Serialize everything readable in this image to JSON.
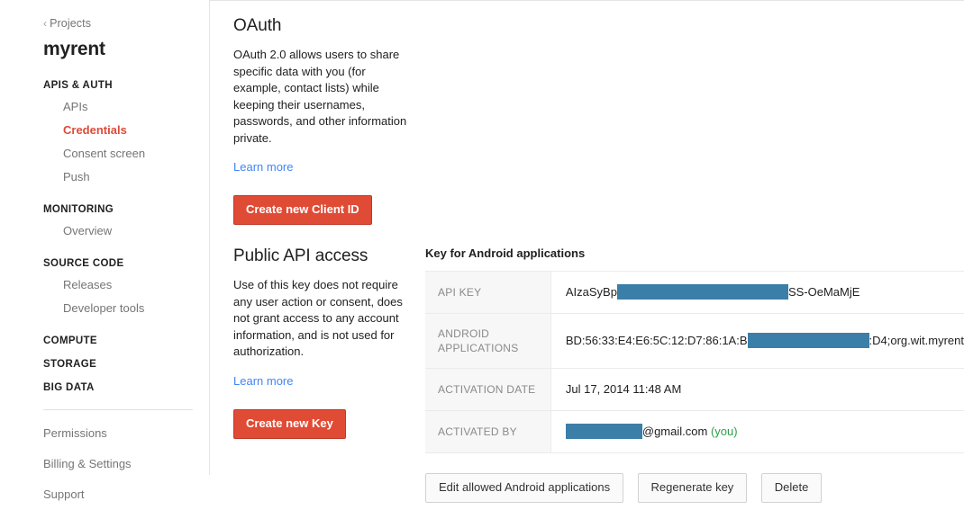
{
  "sidebar": {
    "breadcrumb": {
      "chevron": "‹",
      "label": "Projects"
    },
    "project_title": "myrent",
    "groups": [
      {
        "heading": "APIS & AUTH",
        "items": [
          {
            "label": "APIs",
            "active": false
          },
          {
            "label": "Credentials",
            "active": true
          },
          {
            "label": "Consent screen",
            "active": false
          },
          {
            "label": "Push",
            "active": false
          }
        ]
      },
      {
        "heading": "MONITORING",
        "items": [
          {
            "label": "Overview",
            "active": false
          }
        ]
      },
      {
        "heading": "SOURCE CODE",
        "items": [
          {
            "label": "Releases",
            "active": false
          },
          {
            "label": "Developer tools",
            "active": false
          }
        ]
      }
    ],
    "standalone_headings": [
      "COMPUTE",
      "STORAGE",
      "BIG DATA"
    ],
    "footer_items": [
      "Permissions",
      "Billing & Settings",
      "Support"
    ],
    "active_color": "#dd4b39"
  },
  "oauth": {
    "title": "OAuth",
    "body": "OAuth 2.0 allows users to share specific data with you (for example, contact lists) while keeping their usernames, passwords, and other information private.",
    "learn_more": "Learn more",
    "button": "Create new Client ID"
  },
  "public_api": {
    "title": "Public API access",
    "body": "Use of this key does not require any user action or consent, does not grant access to any account information, and is not used for authorization.",
    "learn_more": "Learn more",
    "button": "Create new Key"
  },
  "key_panel": {
    "heading": "Key for Android applications",
    "rows": {
      "api_key": {
        "label": "API KEY",
        "prefix": "AIzaSyBp",
        "redacted_width": 190,
        "suffix": "SS-OeMaMjE"
      },
      "android_applications": {
        "label": "ANDROID APPLICATIONS",
        "label_line1": "ANDROID",
        "label_line2": "APPLICATIONS",
        "prefix": "BD:56:33:E4:E6:5C:12:D7:86:1A:B",
        "redacted_width": 135,
        "suffix": ":D4;org.wit.myrent"
      },
      "activation_date": {
        "label": "ACTIVATION DATE",
        "value": "Jul 17, 2014 11:48 AM"
      },
      "activated_by": {
        "label": "ACTIVATED BY",
        "redacted_width": 85,
        "suffix": "@gmail.com",
        "you": "(you)"
      }
    },
    "buttons": [
      "Edit allowed Android applications",
      "Regenerate key",
      "Delete"
    ]
  },
  "colors": {
    "accent_red": "#e04b35",
    "link_blue": "#4285f4",
    "redaction": "#3b7ea8",
    "you_green": "#2e9f4a"
  }
}
